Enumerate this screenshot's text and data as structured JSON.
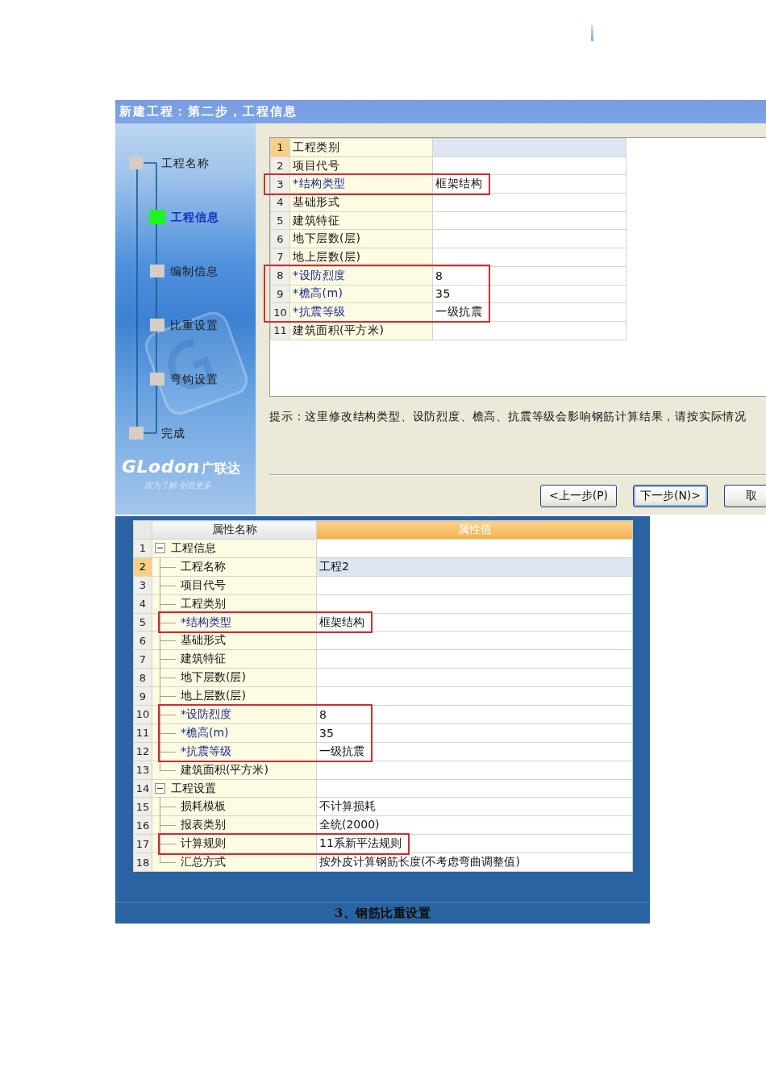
{
  "dialog": {
    "title": "新建工程：第二步，工程信息",
    "steps": [
      {
        "label": "工程名称",
        "selected": false
      },
      {
        "label": "工程信息",
        "selected": true
      },
      {
        "label": "编制信息",
        "selected": false
      },
      {
        "label": "比重设置",
        "selected": false
      },
      {
        "label": "弯钩设置",
        "selected": false
      },
      {
        "label": "完成",
        "selected": false
      }
    ],
    "logo": {
      "brand": "GLodon",
      "brand_cn": "广联达",
      "slogan": "因为了解 创造更多"
    },
    "table": {
      "rows": [
        {
          "number": "1",
          "name": "工程类别",
          "required": false,
          "selected": true,
          "highlighted": false
        },
        {
          "number": "2",
          "name": "项目代号",
          "required": false,
          "selected": false,
          "highlighted": false
        },
        {
          "number": "3",
          "name": "*结构类型",
          "value": "框架结构",
          "required": true,
          "selected": false,
          "highlighted": true
        },
        {
          "number": "4",
          "name": "基础形式",
          "required": false,
          "selected": false,
          "highlighted": false
        },
        {
          "number": "5",
          "name": "建筑特征",
          "required": false,
          "selected": false,
          "highlighted": false
        },
        {
          "number": "6",
          "name": "地下层数(层)",
          "required": false,
          "selected": false,
          "highlighted": false
        },
        {
          "number": "7",
          "name": "地上层数(层)",
          "required": false,
          "selected": false,
          "highlighted": false
        },
        {
          "number": "8",
          "name": "*设防烈度",
          "value": "8",
          "required": true,
          "selected": false,
          "highlighted": true
        },
        {
          "number": "9",
          "name": "*檐高(m)",
          "value": "35",
          "required": true,
          "selected": false,
          "highlighted": true
        },
        {
          "number": "10",
          "name": "*抗震等级",
          "value": "一级抗震",
          "required": true,
          "selected": false,
          "highlighted": true
        },
        {
          "number": "11",
          "name": "建筑面积(平方米)",
          "required": false,
          "selected": false,
          "highlighted": false
        }
      ]
    },
    "hint": "提示：这里修改结构类型、设防烈度、檐高、抗震等级会影响钢筋计算结果，请按实际情况",
    "buttons": [
      {
        "label": "<上一步(P)",
        "focused": false
      },
      {
        "label": "下一步(N)>",
        "focused": true
      },
      {
        "label": "取",
        "focused": false
      }
    ]
  },
  "property_table": {
    "columns": [
      {
        "label": "属性名称",
        "selected": false
      },
      {
        "label": "属性值",
        "selected": true
      }
    ],
    "rows": [
      {
        "number": "1",
        "name": "工程信息",
        "expanded": true,
        "required": false,
        "selected": false,
        "highlighted": false,
        "children": [
          {
            "number": "2",
            "name": "工程名称",
            "value": "工程2",
            "required": false,
            "selected": true,
            "highlighted": false
          },
          {
            "number": "3",
            "name": "项目代号",
            "required": false,
            "selected": false,
            "highlighted": false
          },
          {
            "number": "4",
            "name": "工程类别",
            "required": false,
            "selected": false,
            "highlighted": false
          },
          {
            "number": "5",
            "name": "*结构类型",
            "value": "框架结构",
            "required": true,
            "selected": false,
            "highlighted": true
          },
          {
            "number": "6",
            "name": "基础形式",
            "required": false,
            "selected": false,
            "highlighted": false
          },
          {
            "number": "7",
            "name": "建筑特征",
            "required": false,
            "selected": false,
            "highlighted": false
          },
          {
            "number": "8",
            "name": "地下层数(层)",
            "required": false,
            "selected": false,
            "highlighted": false
          },
          {
            "number": "9",
            "name": "地上层数(层)",
            "required": false,
            "selected": false,
            "highlighted": false
          },
          {
            "number": "10",
            "name": "*设防烈度",
            "value": "8",
            "required": true,
            "selected": false,
            "highlighted": true
          },
          {
            "number": "11",
            "name": "*檐高(m)",
            "value": "35",
            "required": true,
            "selected": false,
            "highlighted": true
          },
          {
            "number": "12",
            "name": "*抗震等级",
            "value": "一级抗震",
            "required": true,
            "selected": false,
            "highlighted": true
          },
          {
            "number": "13",
            "name": "建筑面积(平方米)",
            "required": false,
            "selected": false,
            "highlighted": false
          }
        ]
      },
      {
        "number": "14",
        "name": "工程设置",
        "expanded": true,
        "required": false,
        "selected": false,
        "highlighted": false,
        "children": [
          {
            "number": "15",
            "name": "损耗模板",
            "value": "不计算损耗",
            "required": false,
            "selected": false,
            "highlighted": false
          },
          {
            "number": "16",
            "name": "报表类别",
            "value": "全统(2000)",
            "required": false,
            "selected": false,
            "highlighted": false
          },
          {
            "number": "17",
            "name": "计算规则",
            "value": "11系新平法规则",
            "required": false,
            "selected": false,
            "highlighted": true
          },
          {
            "number": "18",
            "name": "汇总方式",
            "value": "按外皮计算钢筋长度(不考虑弯曲调整值)",
            "required": false,
            "selected": false,
            "highlighted": false
          }
        ]
      }
    ]
  },
  "caption": "3、钢筋比重设置"
}
